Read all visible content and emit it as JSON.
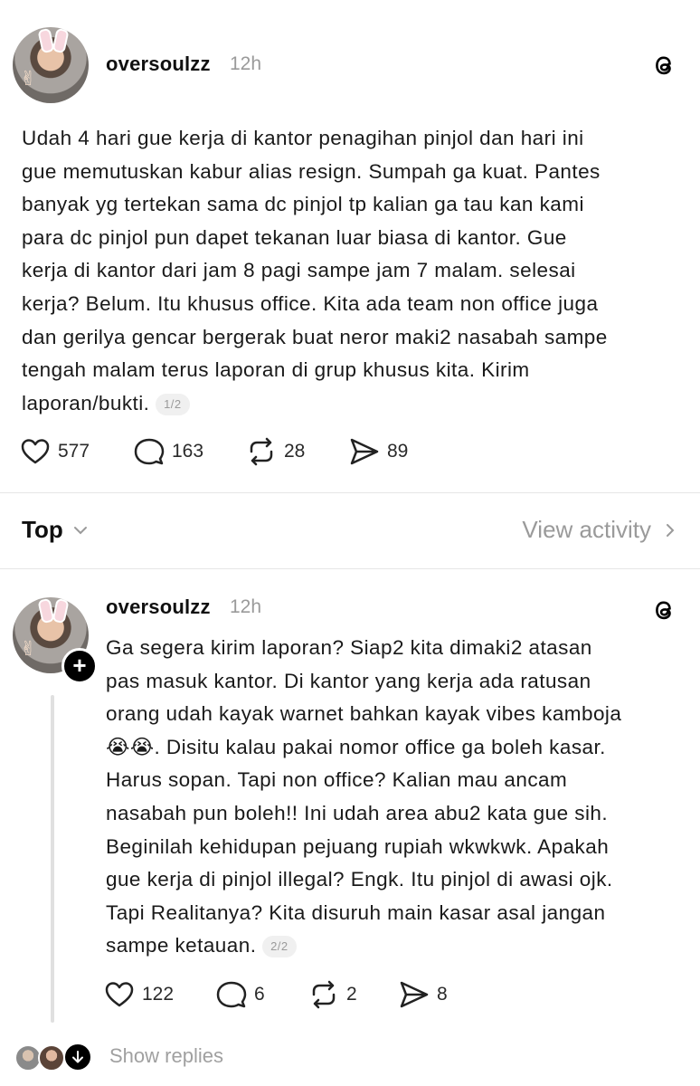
{
  "posts": [
    {
      "username": "oversoulzz",
      "time": "12h",
      "text": "Udah 4 hari gue kerja di kantor penagihan pinjol dan hari ini\ngue memutuskan kabur alias resign. Sumpah ga kuat. Pantes\nbanyak yg tertekan sama dc pinjol tp kalian ga tau kan kami\npara dc pinjol pun dapet tekanan luar biasa di kantor. Gue\nkerja di kantor dari jam 8 pagi sampe jam 7 malam. selesai\nkerja? Belum. Itu khusus office. Kita ada team non office juga\ndan gerilya gencar bergerak buat neror maki2 nasabah sampe\ntengah malam terus laporan di grup khusus kita. Kirim\nlaporan/bukti. ",
      "pager": "1/2",
      "likes": "577",
      "comments": "163",
      "reposts": "28",
      "shares": "89"
    },
    {
      "username": "oversoulzz",
      "time": "12h",
      "text": "Ga segera kirim laporan? Siap2 kita dimaki2 atasan\npas masuk kantor. Di kantor yang kerja ada ratusan\norang udah kayak warnet bahkan kayak vibes kamboja\n😭😭. Disitu kalau pakai nomor office ga boleh kasar.\nHarus sopan. Tapi non office? Kalian mau ancam\nnasabah pun boleh!! Ini udah area abu2 kata gue sih.\nBeginilah kehidupan pejuang rupiah  wkwkwk. Apakah\ngue kerja di pinjol illegal? Engk. Itu pinjol di awasi ojk.\nTapi Realitanya? Kita disuruh main kasar asal jangan\nsampe ketauan. ",
      "pager": "2/2",
      "likes": "122",
      "comments": "6",
      "reposts": "2",
      "shares": "8"
    }
  ],
  "sort_label": "Top",
  "view_activity_label": "View activity",
  "show_replies_label": "Show replies",
  "icons": {
    "like": "heart-icon",
    "comment": "comment-icon",
    "repost": "repost-icon",
    "share": "share-icon",
    "threads": "threads-logo-icon"
  }
}
